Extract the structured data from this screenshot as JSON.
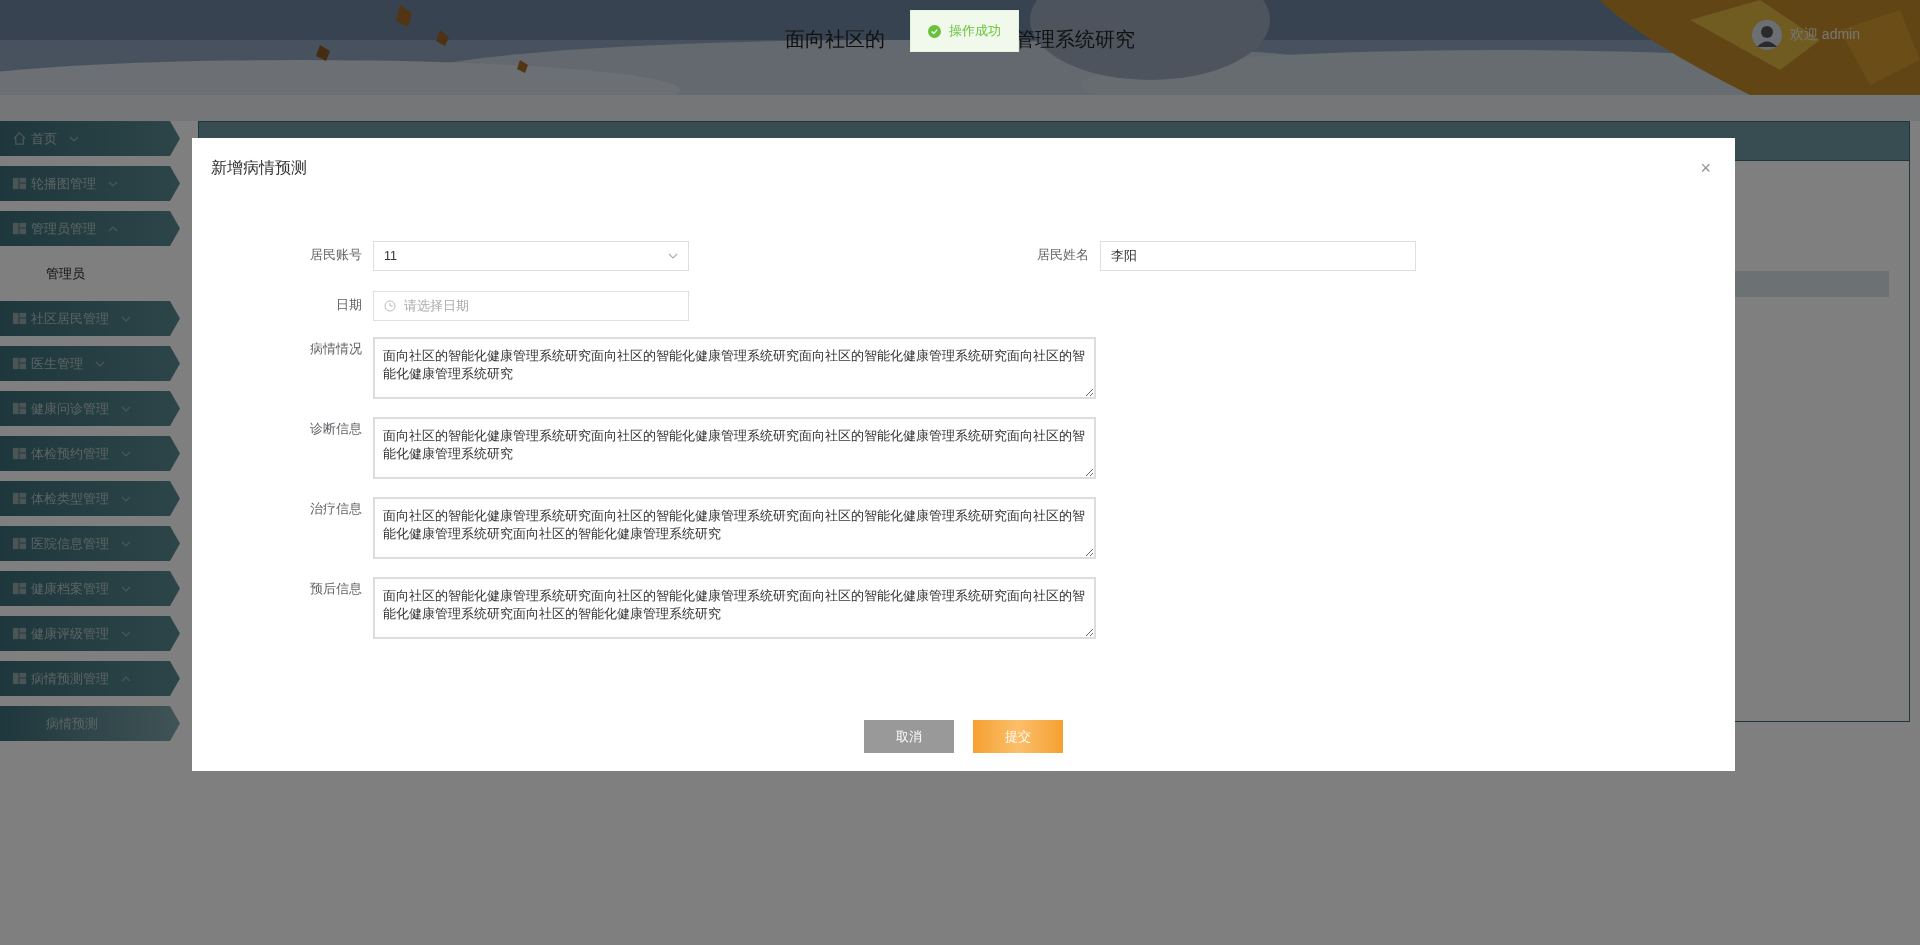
{
  "header": {
    "title_parts": [
      "面向社区的",
      "管理系统研究"
    ],
    "welcome": "欢迎 admin"
  },
  "toast": {
    "text": "操作成功"
  },
  "sidebar": {
    "items": [
      {
        "label": "首页",
        "expanded": false
      },
      {
        "label": "轮播图管理",
        "expanded": false
      },
      {
        "label": "管理员管理",
        "expanded": true,
        "children": [
          {
            "label": "管理员",
            "selected": false
          }
        ]
      },
      {
        "label": "社区居民管理",
        "expanded": false
      },
      {
        "label": "医生管理",
        "expanded": false
      },
      {
        "label": "健康问诊管理",
        "expanded": false
      },
      {
        "label": "体检预约管理",
        "expanded": false
      },
      {
        "label": "体检类型管理",
        "expanded": false
      },
      {
        "label": "医院信息管理",
        "expanded": false
      },
      {
        "label": "健康档案管理",
        "expanded": false
      },
      {
        "label": "健康评级管理",
        "expanded": false
      },
      {
        "label": "病情预测管理",
        "expanded": true,
        "children": [
          {
            "label": "病情预测",
            "selected": true
          }
        ]
      }
    ]
  },
  "dialog": {
    "title": "新增病情预测",
    "close": "×",
    "rows": [
      [
        {
          "kind": "select",
          "label": "居民账号",
          "value": "11"
        },
        {
          "kind": "input",
          "label": "居民姓名",
          "value": "李阳"
        }
      ],
      [
        {
          "kind": "date",
          "label": "日期",
          "placeholder": "请选择日期"
        }
      ],
      [
        {
          "kind": "textarea",
          "label": "病情情况",
          "value": "面向社区的智能化健康管理系统研究面向社区的智能化健康管理系统研究面向社区的智能化健康管理系统研究面向社区的智能化健康管理系统研究"
        }
      ],
      [
        {
          "kind": "textarea",
          "label": "诊断信息",
          "value": "面向社区的智能化健康管理系统研究面向社区的智能化健康管理系统研究面向社区的智能化健康管理系统研究面向社区的智能化健康管理系统研究"
        }
      ],
      [
        {
          "kind": "textarea",
          "label": "治疗信息",
          "value": "面向社区的智能化健康管理系统研究面向社区的智能化健康管理系统研究面向社区的智能化健康管理系统研究面向社区的智能化健康管理系统研究面向社区的智能化健康管理系统研究"
        }
      ],
      [
        {
          "kind": "textarea",
          "label": "预后信息",
          "value": "面向社区的智能化健康管理系统研究面向社区的智能化健康管理系统研究面向社区的智能化健康管理系统研究面向社区的智能化健康管理系统研究面向社区的智能化健康管理系统研究"
        }
      ]
    ],
    "buttons": [
      {
        "kind": "cancel",
        "label": "取消"
      },
      {
        "kind": "submit",
        "label": "提交"
      }
    ]
  }
}
